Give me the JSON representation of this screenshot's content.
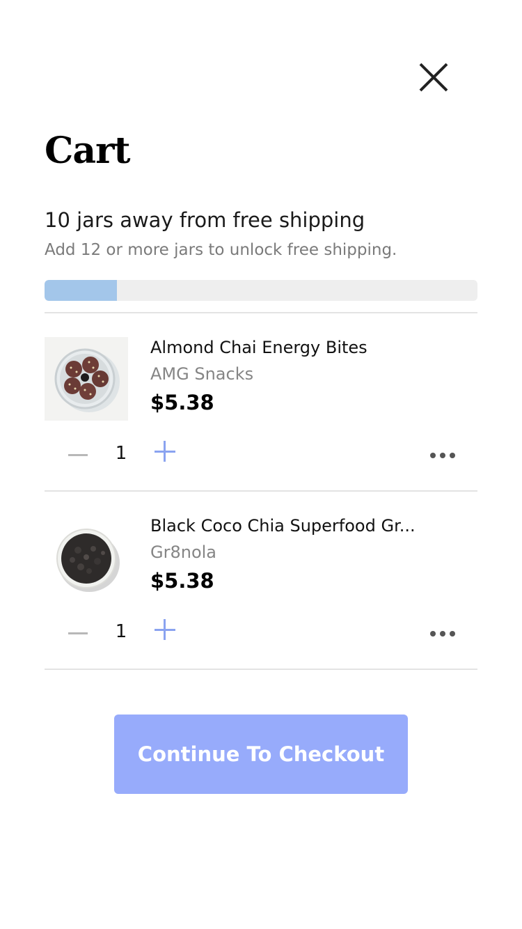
{
  "cart": {
    "title": "Cart",
    "shipping": {
      "headline": "10 jars away from free shipping",
      "subtext": "Add 12 or more jars to unlock free shipping.",
      "progress_fraction": 0.167,
      "progress_color": "#a3c6ea"
    },
    "items": [
      {
        "name": "Almond Chai Energy Bites",
        "brand": "AMG Snacks",
        "price": "$5.38",
        "quantity": "1",
        "image_icon": "energy-bites-bowl"
      },
      {
        "name": "Black Coco Chia Superfood Gr...",
        "brand": "Gr8nola",
        "price": "$5.38",
        "quantity": "1",
        "image_icon": "granola-bowl"
      }
    ],
    "checkout_label": "Continue To Checkout",
    "checkout_color": "#97abfb",
    "accent_color": "#8aa3f0"
  }
}
